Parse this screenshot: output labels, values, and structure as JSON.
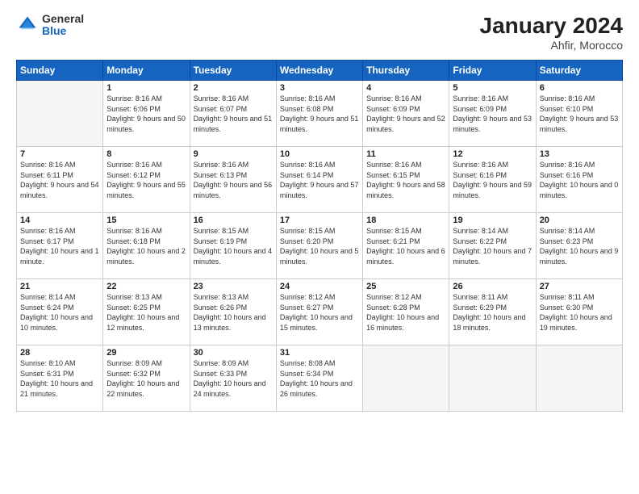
{
  "header": {
    "logo_general": "General",
    "logo_blue": "Blue",
    "month_title": "January 2024",
    "location": "Ahfir, Morocco"
  },
  "weekdays": [
    "Sunday",
    "Monday",
    "Tuesday",
    "Wednesday",
    "Thursday",
    "Friday",
    "Saturday"
  ],
  "weeks": [
    [
      {
        "day": "",
        "sunrise": "",
        "sunset": "",
        "daylight": "",
        "empty": true
      },
      {
        "day": "1",
        "sunrise": "Sunrise: 8:16 AM",
        "sunset": "Sunset: 6:06 PM",
        "daylight": "Daylight: 9 hours and 50 minutes."
      },
      {
        "day": "2",
        "sunrise": "Sunrise: 8:16 AM",
        "sunset": "Sunset: 6:07 PM",
        "daylight": "Daylight: 9 hours and 51 minutes."
      },
      {
        "day": "3",
        "sunrise": "Sunrise: 8:16 AM",
        "sunset": "Sunset: 6:08 PM",
        "daylight": "Daylight: 9 hours and 51 minutes."
      },
      {
        "day": "4",
        "sunrise": "Sunrise: 8:16 AM",
        "sunset": "Sunset: 6:09 PM",
        "daylight": "Daylight: 9 hours and 52 minutes."
      },
      {
        "day": "5",
        "sunrise": "Sunrise: 8:16 AM",
        "sunset": "Sunset: 6:09 PM",
        "daylight": "Daylight: 9 hours and 53 minutes."
      },
      {
        "day": "6",
        "sunrise": "Sunrise: 8:16 AM",
        "sunset": "Sunset: 6:10 PM",
        "daylight": "Daylight: 9 hours and 53 minutes."
      }
    ],
    [
      {
        "day": "7",
        "sunrise": "Sunrise: 8:16 AM",
        "sunset": "Sunset: 6:11 PM",
        "daylight": "Daylight: 9 hours and 54 minutes."
      },
      {
        "day": "8",
        "sunrise": "Sunrise: 8:16 AM",
        "sunset": "Sunset: 6:12 PM",
        "daylight": "Daylight: 9 hours and 55 minutes."
      },
      {
        "day": "9",
        "sunrise": "Sunrise: 8:16 AM",
        "sunset": "Sunset: 6:13 PM",
        "daylight": "Daylight: 9 hours and 56 minutes."
      },
      {
        "day": "10",
        "sunrise": "Sunrise: 8:16 AM",
        "sunset": "Sunset: 6:14 PM",
        "daylight": "Daylight: 9 hours and 57 minutes."
      },
      {
        "day": "11",
        "sunrise": "Sunrise: 8:16 AM",
        "sunset": "Sunset: 6:15 PM",
        "daylight": "Daylight: 9 hours and 58 minutes."
      },
      {
        "day": "12",
        "sunrise": "Sunrise: 8:16 AM",
        "sunset": "Sunset: 6:16 PM",
        "daylight": "Daylight: 9 hours and 59 minutes."
      },
      {
        "day": "13",
        "sunrise": "Sunrise: 8:16 AM",
        "sunset": "Sunset: 6:16 PM",
        "daylight": "Daylight: 10 hours and 0 minutes."
      }
    ],
    [
      {
        "day": "14",
        "sunrise": "Sunrise: 8:16 AM",
        "sunset": "Sunset: 6:17 PM",
        "daylight": "Daylight: 10 hours and 1 minute."
      },
      {
        "day": "15",
        "sunrise": "Sunrise: 8:16 AM",
        "sunset": "Sunset: 6:18 PM",
        "daylight": "Daylight: 10 hours and 2 minutes."
      },
      {
        "day": "16",
        "sunrise": "Sunrise: 8:15 AM",
        "sunset": "Sunset: 6:19 PM",
        "daylight": "Daylight: 10 hours and 4 minutes."
      },
      {
        "day": "17",
        "sunrise": "Sunrise: 8:15 AM",
        "sunset": "Sunset: 6:20 PM",
        "daylight": "Daylight: 10 hours and 5 minutes."
      },
      {
        "day": "18",
        "sunrise": "Sunrise: 8:15 AM",
        "sunset": "Sunset: 6:21 PM",
        "daylight": "Daylight: 10 hours and 6 minutes."
      },
      {
        "day": "19",
        "sunrise": "Sunrise: 8:14 AM",
        "sunset": "Sunset: 6:22 PM",
        "daylight": "Daylight: 10 hours and 7 minutes."
      },
      {
        "day": "20",
        "sunrise": "Sunrise: 8:14 AM",
        "sunset": "Sunset: 6:23 PM",
        "daylight": "Daylight: 10 hours and 9 minutes."
      }
    ],
    [
      {
        "day": "21",
        "sunrise": "Sunrise: 8:14 AM",
        "sunset": "Sunset: 6:24 PM",
        "daylight": "Daylight: 10 hours and 10 minutes."
      },
      {
        "day": "22",
        "sunrise": "Sunrise: 8:13 AM",
        "sunset": "Sunset: 6:25 PM",
        "daylight": "Daylight: 10 hours and 12 minutes."
      },
      {
        "day": "23",
        "sunrise": "Sunrise: 8:13 AM",
        "sunset": "Sunset: 6:26 PM",
        "daylight": "Daylight: 10 hours and 13 minutes."
      },
      {
        "day": "24",
        "sunrise": "Sunrise: 8:12 AM",
        "sunset": "Sunset: 6:27 PM",
        "daylight": "Daylight: 10 hours and 15 minutes."
      },
      {
        "day": "25",
        "sunrise": "Sunrise: 8:12 AM",
        "sunset": "Sunset: 6:28 PM",
        "daylight": "Daylight: 10 hours and 16 minutes."
      },
      {
        "day": "26",
        "sunrise": "Sunrise: 8:11 AM",
        "sunset": "Sunset: 6:29 PM",
        "daylight": "Daylight: 10 hours and 18 minutes."
      },
      {
        "day": "27",
        "sunrise": "Sunrise: 8:11 AM",
        "sunset": "Sunset: 6:30 PM",
        "daylight": "Daylight: 10 hours and 19 minutes."
      }
    ],
    [
      {
        "day": "28",
        "sunrise": "Sunrise: 8:10 AM",
        "sunset": "Sunset: 6:31 PM",
        "daylight": "Daylight: 10 hours and 21 minutes."
      },
      {
        "day": "29",
        "sunrise": "Sunrise: 8:09 AM",
        "sunset": "Sunset: 6:32 PM",
        "daylight": "Daylight: 10 hours and 22 minutes."
      },
      {
        "day": "30",
        "sunrise": "Sunrise: 8:09 AM",
        "sunset": "Sunset: 6:33 PM",
        "daylight": "Daylight: 10 hours and 24 minutes."
      },
      {
        "day": "31",
        "sunrise": "Sunrise: 8:08 AM",
        "sunset": "Sunset: 6:34 PM",
        "daylight": "Daylight: 10 hours and 26 minutes."
      },
      {
        "day": "",
        "sunrise": "",
        "sunset": "",
        "daylight": "",
        "empty": true
      },
      {
        "day": "",
        "sunrise": "",
        "sunset": "",
        "daylight": "",
        "empty": true
      },
      {
        "day": "",
        "sunrise": "",
        "sunset": "",
        "daylight": "",
        "empty": true
      }
    ]
  ]
}
